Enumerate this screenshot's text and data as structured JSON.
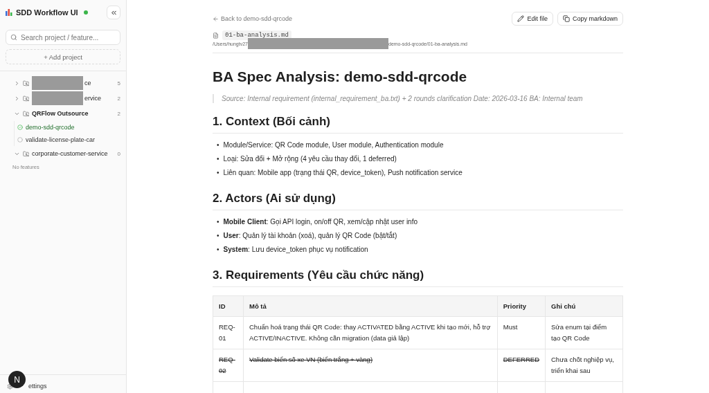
{
  "sidebar": {
    "title": "SDD Workflow UI",
    "online": true,
    "search": {
      "placeholder": "Search project / feature..."
    },
    "add_project": "+ Add project",
    "projects": [
      {
        "name": "ce",
        "redacted": true,
        "expanded": false,
        "bold": false,
        "count": "5"
      },
      {
        "name": "ervice",
        "redacted": true,
        "expanded": false,
        "bold": false,
        "count": "2"
      },
      {
        "name": "QRFlow Outsource",
        "redacted": false,
        "expanded": true,
        "bold": true,
        "count": "2",
        "children": [
          {
            "name": "demo-sdd-qrcode",
            "done": true
          },
          {
            "name": "validate-license-plate-car",
            "done": false
          }
        ]
      },
      {
        "name": "corporate-customer-service",
        "redacted": false,
        "expanded": true,
        "bold": false,
        "count": "0",
        "empty_text": "No features"
      }
    ],
    "settings": "ettings",
    "avatar": "N"
  },
  "header": {
    "back": "Back to demo-sdd-qrcode",
    "buttons": [
      {
        "kind": "edit",
        "label": "Edit file"
      },
      {
        "kind": "copy",
        "label": "Copy markdown"
      }
    ],
    "file_name": "01-ba-analysis.md",
    "path_start": "/Users/hungtv27",
    "path_end": "demo-sdd-qrcode/01-ba-analysis.md"
  },
  "doc": {
    "title": "BA Spec Analysis: demo-sdd-qrcode",
    "quote": "Source: Internal requirement (internal_requirement_ba.txt) + 2 rounds clarification Date: 2026-03-16 BA: Internal team",
    "sections": [
      {
        "heading": "1. Context (Bối cảnh)",
        "bullet": "•",
        "items": [
          "Module/Service: QR Code module, User module, Authentication module",
          "Loại: Sửa đổi + Mở rộng (4 yêu cầu thay đổi, 1 deferred)",
          "Liên quan: Mobile app (trạng thái QR, device_token), Push notification service"
        ]
      },
      {
        "heading": "2. Actors (Ai sử dụng)",
        "bullet": "•",
        "items": [
          "**Mobile Client**: Gọi API login, on/off QR, xem/cập nhật user info",
          "**User**: Quản lý tài khoản (xoá), quản lý QR Code (bật/tắt)",
          "**System**: Lưu device_token phục vụ notification"
        ]
      },
      {
        "heading": "3. Requirements (Yêu cầu chức năng)",
        "table": {
          "columns": [
            "ID",
            "Mô tả",
            "Priority",
            "Ghi chú"
          ],
          "rows": [
            {
              "deferred": false,
              "cells": [
                "REQ-01",
                "Chuẩn hoá trạng thái QR Code: thay ACTIVATED bằng ACTIVE khi tạo mới, hỗ trợ ACTIVE/INACTIVE. Không cần migration (data giả lập)",
                "Must",
                "Sửa enum tại điểm tạo QR Code"
              ]
            },
            {
              "deferred": true,
              "cells": [
                "REQ-02",
                "Validate biển số xe VN (biển trắng + vàng)",
                "DEFERRED",
                "Chưa chốt nghiệp vụ, triển khai sau"
              ]
            }
          ]
        }
      }
    ]
  }
}
